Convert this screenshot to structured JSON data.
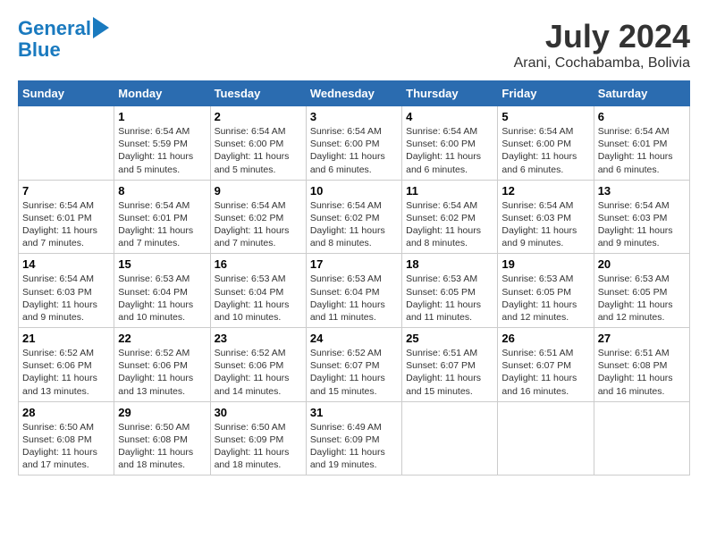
{
  "logo": {
    "line1": "General",
    "line2": "Blue"
  },
  "title": "July 2024",
  "subtitle": "Arani, Cochabamba, Bolivia",
  "headers": [
    "Sunday",
    "Monday",
    "Tuesday",
    "Wednesday",
    "Thursday",
    "Friday",
    "Saturday"
  ],
  "weeks": [
    [
      {
        "day": "",
        "info": ""
      },
      {
        "day": "1",
        "info": "Sunrise: 6:54 AM\nSunset: 5:59 PM\nDaylight: 11 hours\nand 5 minutes."
      },
      {
        "day": "2",
        "info": "Sunrise: 6:54 AM\nSunset: 6:00 PM\nDaylight: 11 hours\nand 5 minutes."
      },
      {
        "day": "3",
        "info": "Sunrise: 6:54 AM\nSunset: 6:00 PM\nDaylight: 11 hours\nand 6 minutes."
      },
      {
        "day": "4",
        "info": "Sunrise: 6:54 AM\nSunset: 6:00 PM\nDaylight: 11 hours\nand 6 minutes."
      },
      {
        "day": "5",
        "info": "Sunrise: 6:54 AM\nSunset: 6:00 PM\nDaylight: 11 hours\nand 6 minutes."
      },
      {
        "day": "6",
        "info": "Sunrise: 6:54 AM\nSunset: 6:01 PM\nDaylight: 11 hours\nand 6 minutes."
      }
    ],
    [
      {
        "day": "7",
        "info": "Sunrise: 6:54 AM\nSunset: 6:01 PM\nDaylight: 11 hours\nand 7 minutes."
      },
      {
        "day": "8",
        "info": "Sunrise: 6:54 AM\nSunset: 6:01 PM\nDaylight: 11 hours\nand 7 minutes."
      },
      {
        "day": "9",
        "info": "Sunrise: 6:54 AM\nSunset: 6:02 PM\nDaylight: 11 hours\nand 7 minutes."
      },
      {
        "day": "10",
        "info": "Sunrise: 6:54 AM\nSunset: 6:02 PM\nDaylight: 11 hours\nand 8 minutes."
      },
      {
        "day": "11",
        "info": "Sunrise: 6:54 AM\nSunset: 6:02 PM\nDaylight: 11 hours\nand 8 minutes."
      },
      {
        "day": "12",
        "info": "Sunrise: 6:54 AM\nSunset: 6:03 PM\nDaylight: 11 hours\nand 9 minutes."
      },
      {
        "day": "13",
        "info": "Sunrise: 6:54 AM\nSunset: 6:03 PM\nDaylight: 11 hours\nand 9 minutes."
      }
    ],
    [
      {
        "day": "14",
        "info": "Sunrise: 6:54 AM\nSunset: 6:03 PM\nDaylight: 11 hours\nand 9 minutes."
      },
      {
        "day": "15",
        "info": "Sunrise: 6:53 AM\nSunset: 6:04 PM\nDaylight: 11 hours\nand 10 minutes."
      },
      {
        "day": "16",
        "info": "Sunrise: 6:53 AM\nSunset: 6:04 PM\nDaylight: 11 hours\nand 10 minutes."
      },
      {
        "day": "17",
        "info": "Sunrise: 6:53 AM\nSunset: 6:04 PM\nDaylight: 11 hours\nand 11 minutes."
      },
      {
        "day": "18",
        "info": "Sunrise: 6:53 AM\nSunset: 6:05 PM\nDaylight: 11 hours\nand 11 minutes."
      },
      {
        "day": "19",
        "info": "Sunrise: 6:53 AM\nSunset: 6:05 PM\nDaylight: 11 hours\nand 12 minutes."
      },
      {
        "day": "20",
        "info": "Sunrise: 6:53 AM\nSunset: 6:05 PM\nDaylight: 11 hours\nand 12 minutes."
      }
    ],
    [
      {
        "day": "21",
        "info": "Sunrise: 6:52 AM\nSunset: 6:06 PM\nDaylight: 11 hours\nand 13 minutes."
      },
      {
        "day": "22",
        "info": "Sunrise: 6:52 AM\nSunset: 6:06 PM\nDaylight: 11 hours\nand 13 minutes."
      },
      {
        "day": "23",
        "info": "Sunrise: 6:52 AM\nSunset: 6:06 PM\nDaylight: 11 hours\nand 14 minutes."
      },
      {
        "day": "24",
        "info": "Sunrise: 6:52 AM\nSunset: 6:07 PM\nDaylight: 11 hours\nand 15 minutes."
      },
      {
        "day": "25",
        "info": "Sunrise: 6:51 AM\nSunset: 6:07 PM\nDaylight: 11 hours\nand 15 minutes."
      },
      {
        "day": "26",
        "info": "Sunrise: 6:51 AM\nSunset: 6:07 PM\nDaylight: 11 hours\nand 16 minutes."
      },
      {
        "day": "27",
        "info": "Sunrise: 6:51 AM\nSunset: 6:08 PM\nDaylight: 11 hours\nand 16 minutes."
      }
    ],
    [
      {
        "day": "28",
        "info": "Sunrise: 6:50 AM\nSunset: 6:08 PM\nDaylight: 11 hours\nand 17 minutes."
      },
      {
        "day": "29",
        "info": "Sunrise: 6:50 AM\nSunset: 6:08 PM\nDaylight: 11 hours\nand 18 minutes."
      },
      {
        "day": "30",
        "info": "Sunrise: 6:50 AM\nSunset: 6:09 PM\nDaylight: 11 hours\nand 18 minutes."
      },
      {
        "day": "31",
        "info": "Sunrise: 6:49 AM\nSunset: 6:09 PM\nDaylight: 11 hours\nand 19 minutes."
      },
      {
        "day": "",
        "info": ""
      },
      {
        "day": "",
        "info": ""
      },
      {
        "day": "",
        "info": ""
      }
    ]
  ]
}
